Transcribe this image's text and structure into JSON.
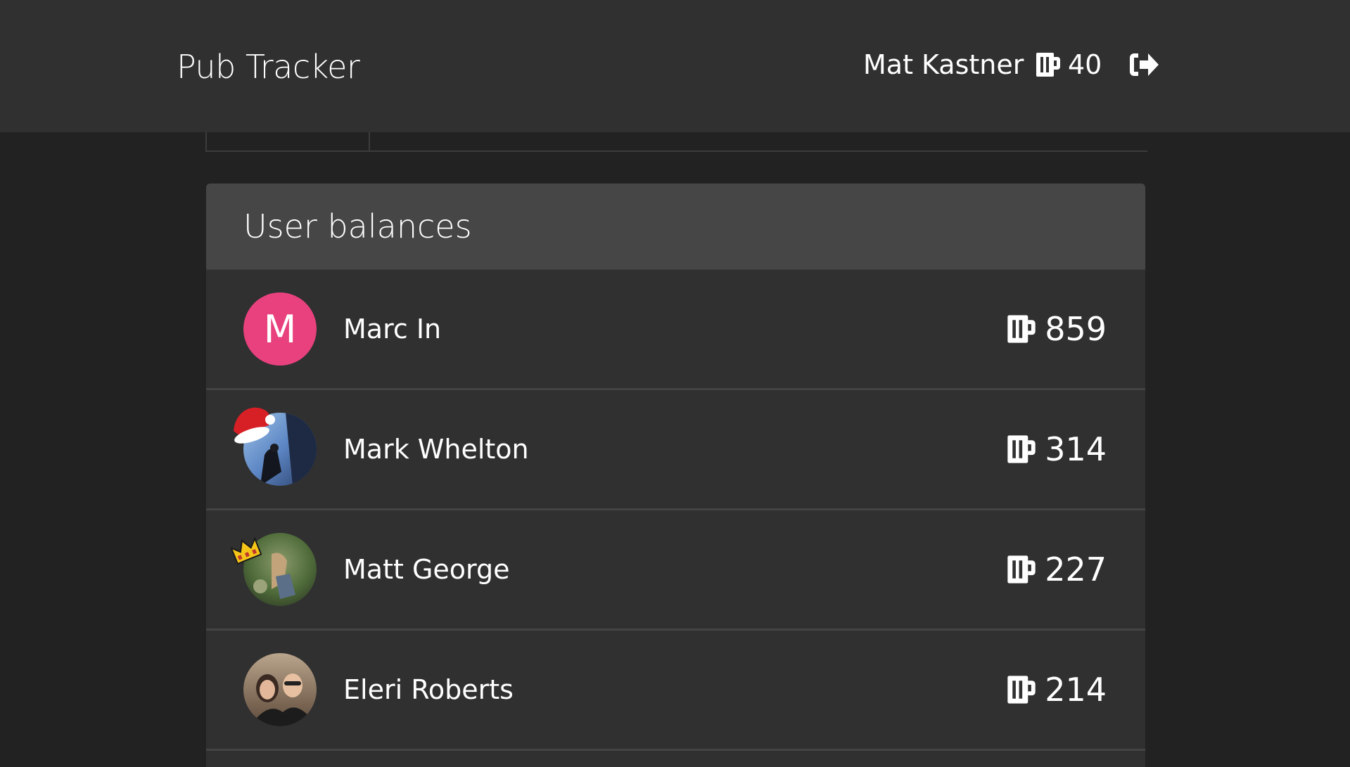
{
  "navbar": {
    "brand": "Pub Tracker",
    "user_name": "Mat Kastner",
    "user_balance": "40",
    "balance_icon": "beer-mug-icon",
    "logout_icon": "sign-out-icon"
  },
  "panel": {
    "title": "User balances"
  },
  "users": [
    {
      "name": "Marc In",
      "initial": "M",
      "balance": "859",
      "avatar_type": "letter",
      "avatar_color": "#e8417e"
    },
    {
      "name": "Mark Whelton",
      "balance": "314",
      "avatar_type": "photo",
      "badge": "santa-hat"
    },
    {
      "name": "Matt George",
      "balance": "227",
      "avatar_type": "photo",
      "badge": "crown"
    },
    {
      "name": "Eleri Roberts",
      "balance": "214",
      "avatar_type": "photo"
    }
  ],
  "colors": {
    "background": "#222222",
    "navbar": "#303030",
    "panel_heading": "#464646",
    "panel_body": "#303030",
    "accent_avatar": "#e8417e"
  }
}
